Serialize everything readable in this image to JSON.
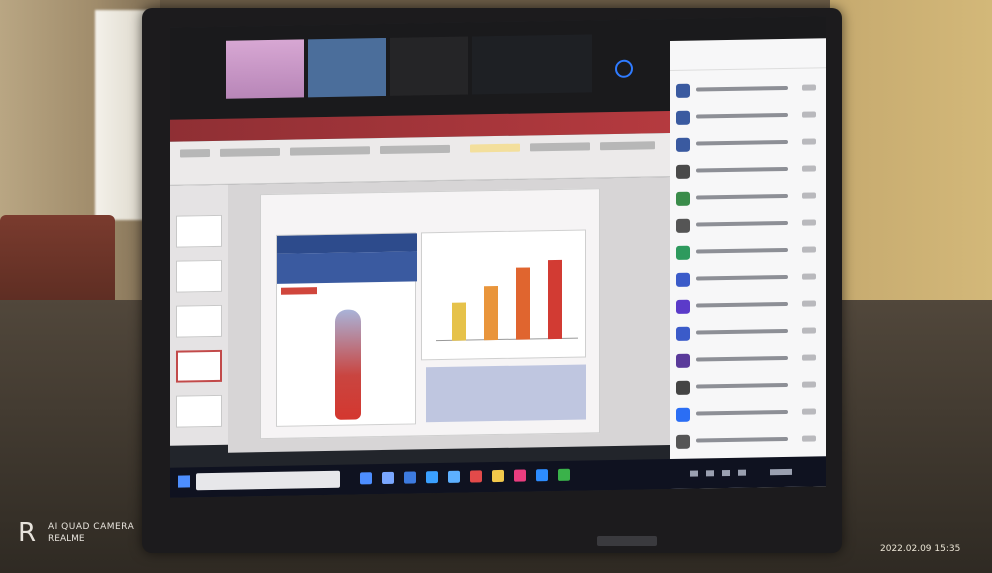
{
  "watermark": {
    "device": "REALME",
    "camera": "AI QUAD CAMERA",
    "timestamp": "2022.02.09 15:35"
  },
  "colors": {
    "ppt_red": "#b53a3f",
    "zoom_blue": "#2b6ef4",
    "info_blue": "#2d4b8c",
    "bar_yellow": "#e6c24a",
    "bar_orange": "#e37a36",
    "bar_red": "#d23b33"
  },
  "icons": [
    "windows-start-icon",
    "search-icon",
    "camera-icon",
    "participant-avatar-icon",
    "mic-icon",
    "video-icon"
  ],
  "slide_chart_bars": [
    {
      "color": "#e6c24a",
      "relative_value": 0.42
    },
    {
      "color": "#e9953b",
      "relative_value": 0.6
    },
    {
      "color": "#e0652f",
      "relative_value": 0.8
    },
    {
      "color": "#d23b33",
      "relative_value": 0.88
    }
  ],
  "participant_avatars": [
    "#3a5aa0",
    "#3a5aa0",
    "#3a5aa0",
    "#4a4a4a",
    "#3a8c4a",
    "#555555",
    "#2e9a5e",
    "#3b5bc9",
    "#5b3bc9",
    "#3b5bc9",
    "#5a3a9a",
    "#444444",
    "#2b6ef4",
    "#555555"
  ]
}
